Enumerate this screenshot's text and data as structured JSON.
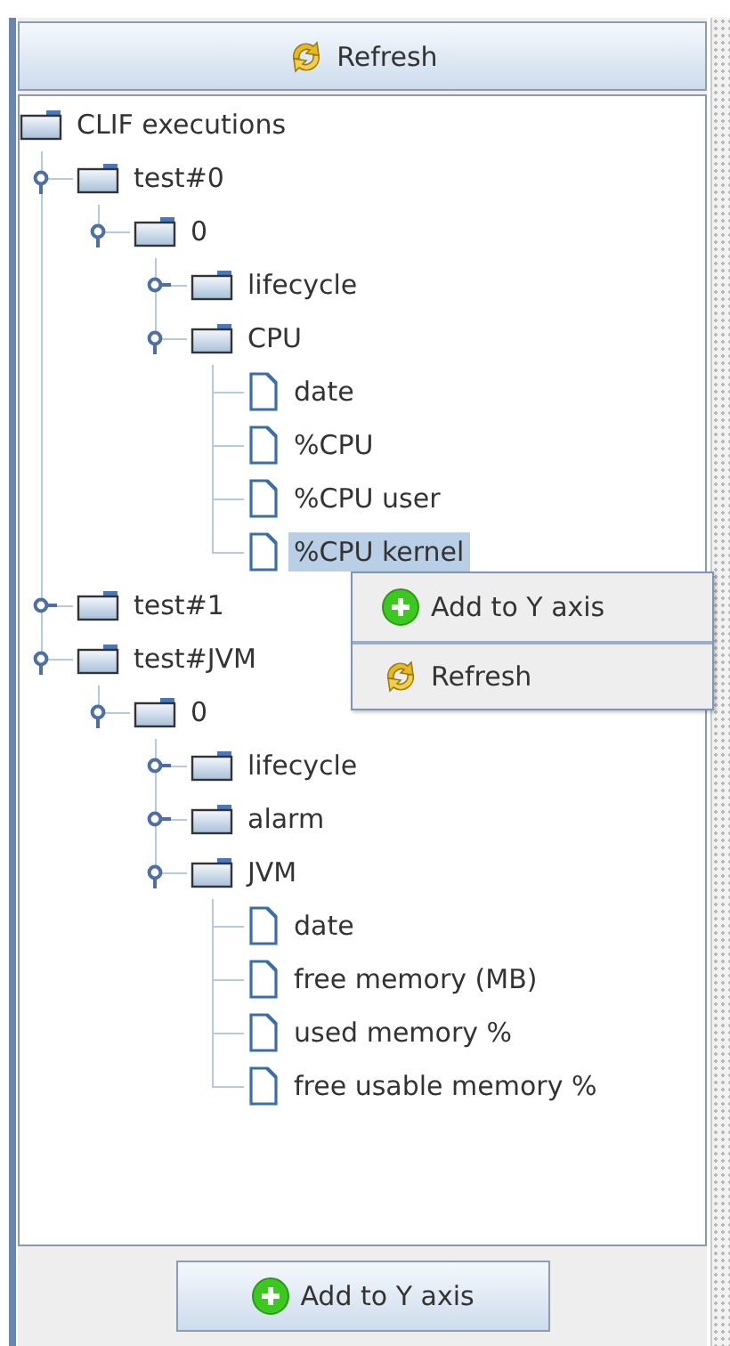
{
  "toolbar": {
    "refresh_button": "Refresh"
  },
  "tree": {
    "label": "CLIF executions",
    "kind": "folder",
    "selected": false,
    "children": [
      {
        "label": "test#0",
        "kind": "folder",
        "expanded": true,
        "selected": false,
        "children": [
          {
            "label": "0",
            "kind": "folder",
            "expanded": true,
            "selected": false,
            "children": [
              {
                "label": "lifecycle",
                "kind": "folder",
                "expanded": false,
                "selected": false
              },
              {
                "label": "CPU",
                "kind": "folder",
                "expanded": true,
                "selected": false,
                "children": [
                  {
                    "label": "date",
                    "kind": "leaf",
                    "selected": false
                  },
                  {
                    "label": "%CPU",
                    "kind": "leaf",
                    "selected": false
                  },
                  {
                    "label": "%CPU user",
                    "kind": "leaf",
                    "selected": false
                  },
                  {
                    "label": "%CPU kernel",
                    "kind": "leaf",
                    "selected": true
                  }
                ]
              }
            ]
          }
        ]
      },
      {
        "label": "test#1",
        "kind": "folder",
        "expanded": false,
        "selected": false
      },
      {
        "label": "test#JVM",
        "kind": "folder",
        "expanded": true,
        "selected": false,
        "children": [
          {
            "label": "0",
            "kind": "folder",
            "expanded": true,
            "selected": false,
            "children": [
              {
                "label": "lifecycle",
                "kind": "folder",
                "expanded": false,
                "selected": false
              },
              {
                "label": "alarm",
                "kind": "folder",
                "expanded": false,
                "selected": false
              },
              {
                "label": "JVM",
                "kind": "folder",
                "expanded": true,
                "selected": false,
                "children": [
                  {
                    "label": "date",
                    "kind": "leaf",
                    "selected": false
                  },
                  {
                    "label": "free memory (MB)",
                    "kind": "leaf",
                    "selected": false
                  },
                  {
                    "label": "used memory %",
                    "kind": "leaf",
                    "selected": false
                  },
                  {
                    "label": "free usable memory %",
                    "kind": "leaf",
                    "selected": false
                  }
                ]
              }
            ]
          }
        ]
      }
    ]
  },
  "context_menu": {
    "items": [
      {
        "label": "Add to Y axis",
        "kind": "add"
      },
      {
        "label": "Refresh",
        "kind": "refresh"
      }
    ]
  },
  "footer": {
    "add_button": "Add to Y axis"
  }
}
